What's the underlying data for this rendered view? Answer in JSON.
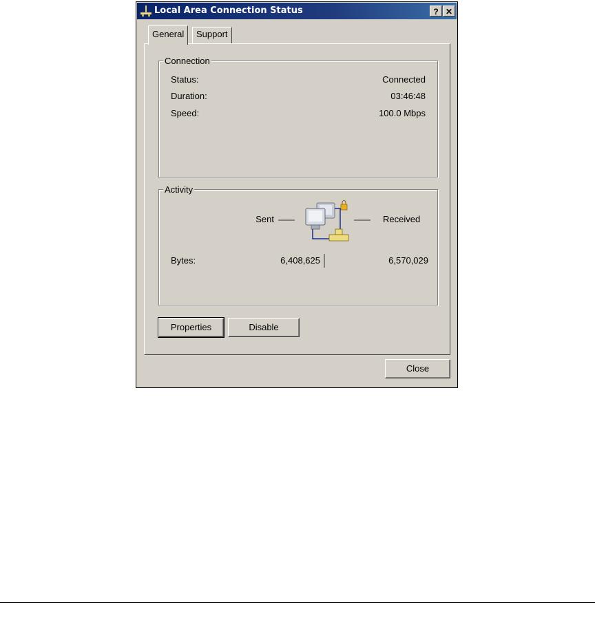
{
  "window": {
    "title": "Local Area Connection Status",
    "help_button": "?",
    "close_button": "✕"
  },
  "tabs": [
    {
      "label": "General",
      "selected": true
    },
    {
      "label": "Support",
      "selected": false
    }
  ],
  "connection": {
    "legend": "Connection",
    "rows": [
      {
        "label": "Status:",
        "value": "Connected"
      },
      {
        "label": "Duration:",
        "value": "03:46:48"
      },
      {
        "label": "Speed:",
        "value": "100.0 Mbps"
      }
    ]
  },
  "activity": {
    "legend": "Activity",
    "sent_label": "Sent",
    "received_label": "Received",
    "bytes_label": "Bytes:",
    "bytes_sent": "6,408,625",
    "bytes_received": "6,570,029",
    "icon": "network-computers-icon"
  },
  "buttons": {
    "properties": "Properties",
    "disable": "Disable",
    "close": "Close"
  },
  "colors": {
    "titlebar": "#0a246a",
    "face": "#d4d0c8"
  }
}
